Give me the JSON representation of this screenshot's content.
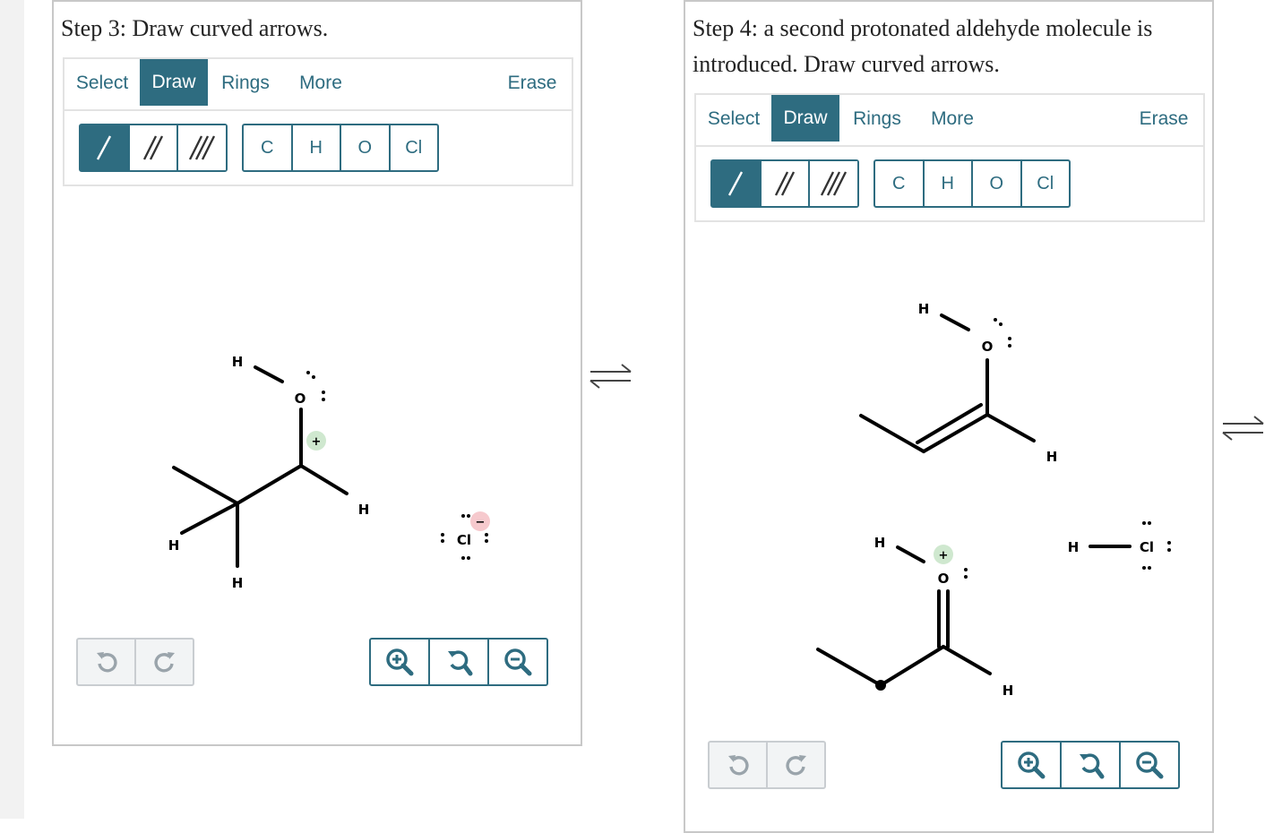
{
  "panels": [
    {
      "title": "Step 3: Draw curved arrows.",
      "tabs": [
        "Select",
        "Draw",
        "Rings",
        "More",
        "Erase"
      ],
      "atoms": [
        "C",
        "H",
        "O",
        "Cl"
      ],
      "molecule_labels": {
        "h_top": "H",
        "o": "O",
        "h_right": "H",
        "h_left": "H",
        "h_bottom": "H",
        "plus": "+",
        "cl": "Cl",
        "minus": "−"
      }
    },
    {
      "title": "Step 4: a second protonated aldehyde molecule is introduced. Draw curved arrows.",
      "tabs": [
        "Select",
        "Draw",
        "Rings",
        "More",
        "Erase"
      ],
      "atoms": [
        "C",
        "H",
        "O",
        "Cl"
      ],
      "molecule_labels": {
        "h_top": "H",
        "o_top": "O",
        "h_mid": "H",
        "h_lower": "H",
        "o_lower": "O",
        "plus": "+",
        "h_bottom": "H",
        "hcl_h": "H",
        "hcl_cl": "Cl"
      }
    }
  ],
  "colors": {
    "accent": "#2e6c80",
    "plus_badge": "#cfe8cf",
    "minus_badge": "#f6c9cd"
  },
  "icons": [
    "single-bond-icon",
    "double-bond-icon",
    "triple-bond-icon",
    "undo-icon",
    "redo-icon",
    "zoom-in-icon",
    "zoom-reset-icon",
    "zoom-out-icon",
    "equilibrium-arrow-icon"
  ]
}
